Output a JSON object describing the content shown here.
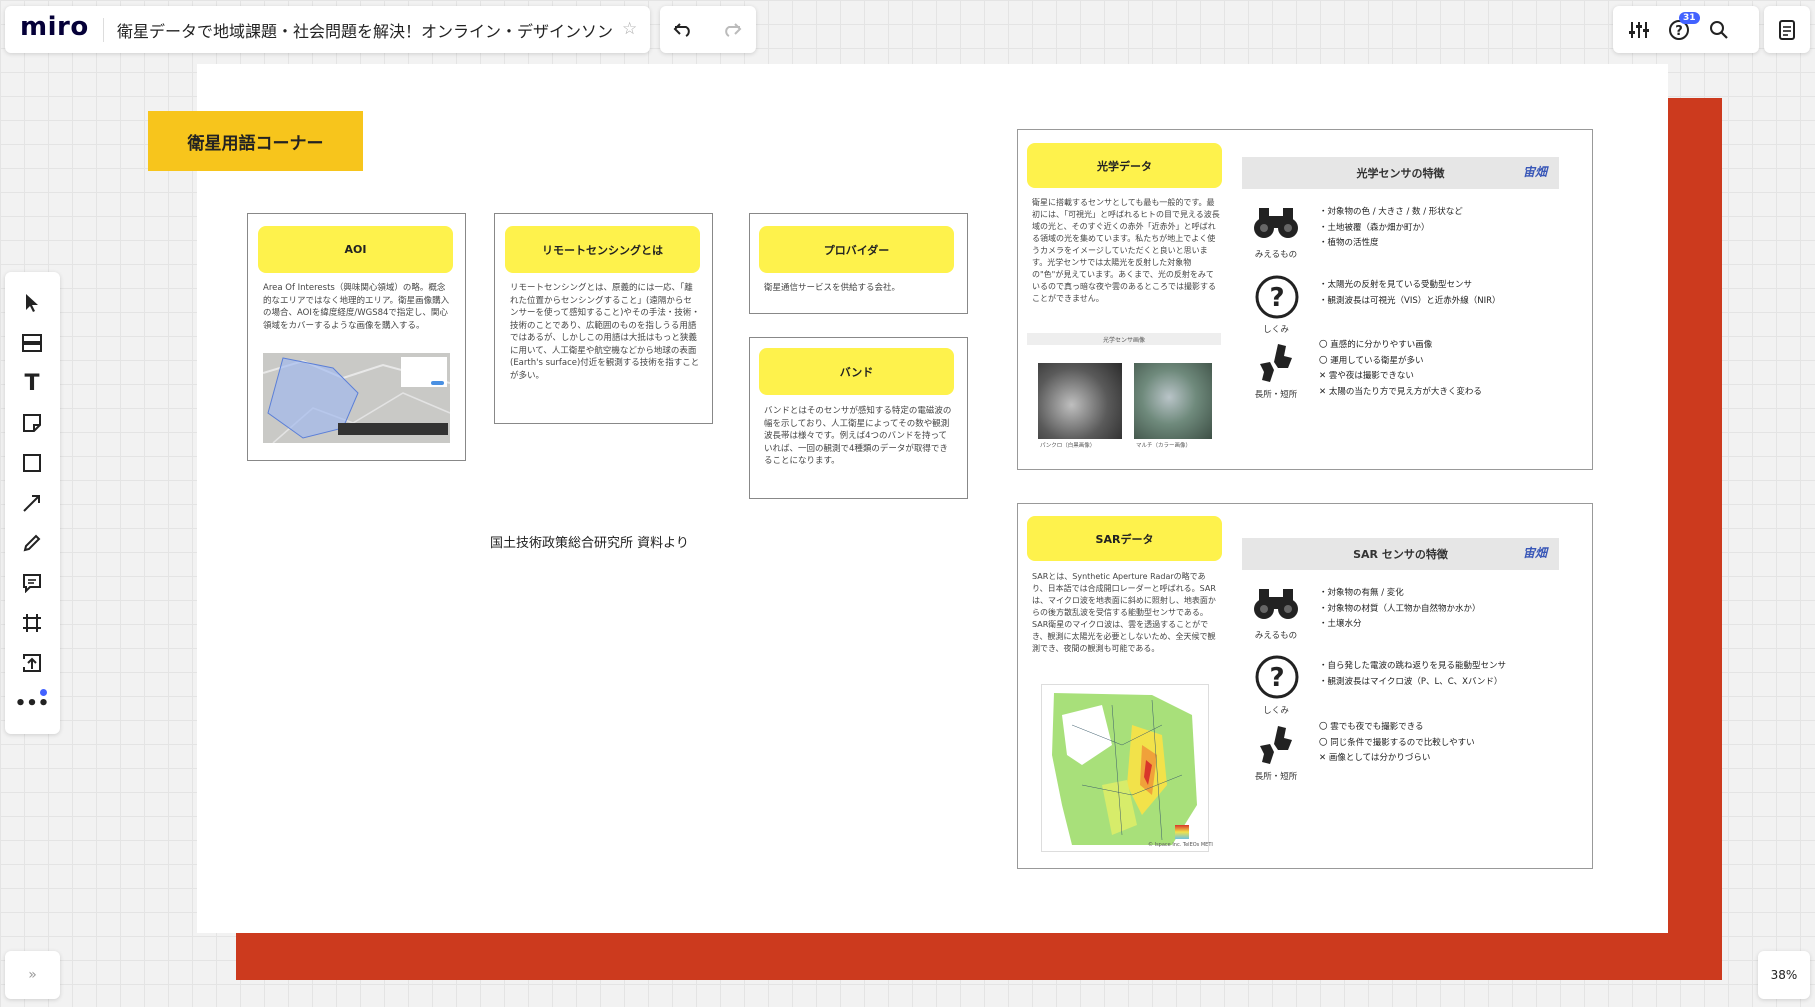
{
  "app": {
    "logo": "miro",
    "board_title": "衛星データで地域課題・社会問題を解決！オンライン・デザインソン",
    "zoom": "38%",
    "notifications": "31"
  },
  "sections": {
    "title": "衛星用語コーナー",
    "source": "国土技術政策総合研究所 資料より"
  },
  "cards": {
    "aoi": {
      "title": "AOI",
      "body": "Area Of Interests（興味関心領域）の略。概念的なエリアではなく地理的エリア。衛星画像購入の場合、AOIを緯度経度/WGS84で指定し、関心領域をカバーするような画像を購入する。"
    },
    "remote": {
      "title": "リモートセンシングとは",
      "body": "リモートセンシングとは、原義的には一応、「離れた位置からセンシングすること」(遠隔からセンサーを使って感知すること)やその手法・技術・技術のことであり、広範囲のものを指しうる用語ではあるが、しかしこの用語は大抵はもっと狭義に用いて、人工衛星や航空機などから地球の表面(Earth's surface)付近を観測する技術を指すことが多い。"
    },
    "provider": {
      "title": "プロバイダー",
      "body": "衛星通信サービスを供給する会社。"
    },
    "band": {
      "title": "バンド",
      "body": "バンドとはそのセンサが感知する特定の電磁波の幅を示しており、人工衛星によってその数や観測波長帯は様々です。例えば4つのバンドを持っていれば、一回の観測で4種類のデータが取得できることになります。"
    }
  },
  "optical": {
    "card_title": "光学データ",
    "body": "衛星に搭載するセンサとしても最も一般的です。最初には、「可視光」と呼ばれるヒトの目で見える波長域の光と、そのすぐ近くの赤外「近赤外」と呼ばれる領域の光を集めています。私たちが地上でよく使うカメラをイメージしていただくと良いと思います。光学センサでは太陽光を反射した対象物の\"色\"が見えています。あくまで、光の反射をみているので真っ暗な夜や雲のあるところでは撮影することができません。",
    "strip": "光学センサ画像",
    "cap1": "パンクロ（白黒画像）",
    "cap2": "マルチ（カラー画像）",
    "feature_title": "光学センサの特徴",
    "brand": "宙畑",
    "labels": {
      "see": "みえるもの",
      "how": "しくみ",
      "pros": "長所・短所"
    },
    "see": [
      "・対象物の色 / 大きさ / 数 / 形状など",
      "・土地被覆（森か畑か町か）",
      "・植物の活性度"
    ],
    "how": [
      "・太陽光の反射を見ている受動型センサ",
      "・観測波長は可視光（VIS）と近赤外線（NIR）"
    ],
    "pros": [
      "〇 直感的に分かりやすい画像",
      "〇 運用している衛星が多い",
      "✕ 雲や夜は撮影できない",
      "✕ 太陽の当たり方で見え方が大きく変わる"
    ]
  },
  "sar": {
    "card_title": "SARデータ",
    "body": "SARとは、Synthetic Aperture Radarの略であり、日本語では合成開口レーダーと呼ばれる。SARは、マイクロ波を地表面に斜めに照射し、地表面からの後方散乱波を受信する能動型センサである。SAR衛星のマイクロ波は、雲を透過することができ、観測に太陽光を必要としないため、全天候で観測でき、夜間の観測も可能である。",
    "map_credit": "© Ispace Inc. TelEOs METI",
    "feature_title": "SAR センサの特徴",
    "brand": "宙畑",
    "labels": {
      "see": "みえるもの",
      "how": "しくみ",
      "pros": "長所・短所"
    },
    "see": [
      "・対象物の有無 / 変化",
      "・対象物の材質（人工物か自然物か水か）",
      "・土壌水分"
    ],
    "how": [
      "・自ら発した電波の跳ね返りを見る能動型センサ",
      "・観測波長はマイクロ波（P、L、C、Xバンド）"
    ],
    "pros": [
      "〇 雲でも夜でも撮影できる",
      "〇 同じ条件で撮影するので比較しやすい",
      "✕ 画像としては分かりづらい"
    ]
  },
  "colors": {
    "yellow": "#fef24c",
    "header_yellow": "#f7c51c",
    "red": "#cc3a1e",
    "accent_blue": "#4262ff"
  }
}
